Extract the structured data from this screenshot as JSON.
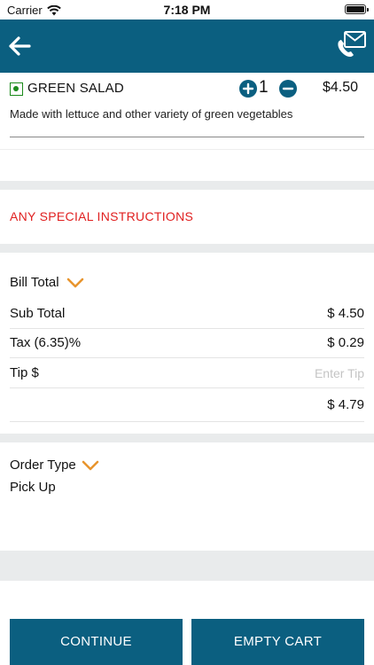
{
  "status_bar": {
    "carrier": "Carrier",
    "time": "7:18 PM",
    "icons": [
      "wifi-icon",
      "battery-icon"
    ]
  },
  "nav": {
    "back_icon": "arrow-left-icon",
    "contact_icon": "phone-mail-icon",
    "bar_color": "#0b5f80"
  },
  "cart_item": {
    "name": "GREEN SALAD",
    "quantity": "1",
    "price": "$4.50",
    "description": "Made with lettuce and other variety of green vegetables",
    "veg_indicator_color": "#1a8a1a"
  },
  "special_instructions": {
    "label": "ANY SPECIAL INSTRUCTIONS",
    "color": "#e02020"
  },
  "bill": {
    "title": "Bill Total",
    "sub_total": {
      "label": "Sub Total",
      "value": "$ 4.50"
    },
    "tax": {
      "label": "Tax (6.35)%",
      "value": "$ 0.29"
    },
    "tip": {
      "label": "Tip $",
      "value": "",
      "placeholder": "Enter Tip"
    },
    "total": {
      "value": "$ 4.79"
    }
  },
  "order_type": {
    "title": "Order Type",
    "value": "Pick Up"
  },
  "chevron_color": "#e8952e",
  "buttons": {
    "continue": "CONTINUE",
    "empty_cart": "EMPTY CART"
  }
}
